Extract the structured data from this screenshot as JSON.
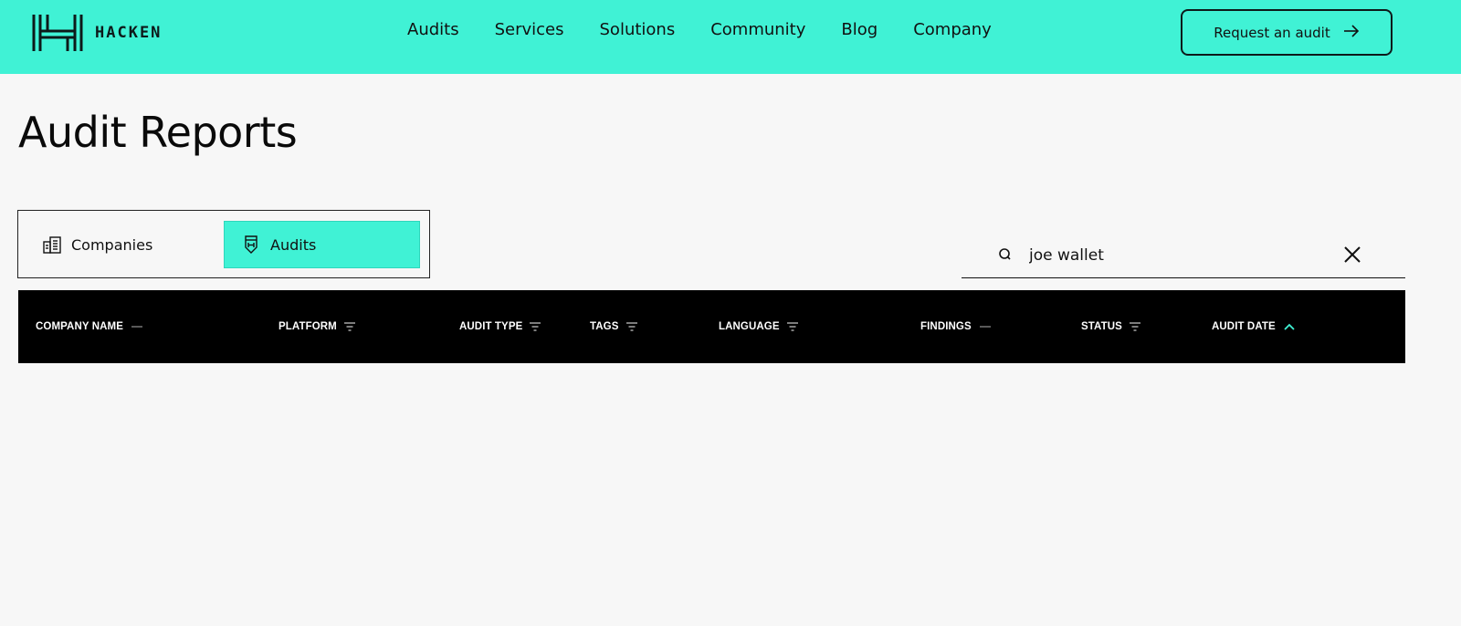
{
  "header": {
    "logo_text": "HACKEN",
    "nav": [
      "Audits",
      "Services",
      "Solutions",
      "Community",
      "Blog",
      "Company"
    ],
    "cta_label": "Request an audit",
    "brand_color": "#40f2d5"
  },
  "page": {
    "title": "Audit Reports"
  },
  "tabs": [
    {
      "label": "Companies",
      "icon": "building-icon",
      "active": false
    },
    {
      "label": "Audits",
      "icon": "shield-icon",
      "active": true
    }
  ],
  "search": {
    "value": "joe wallet"
  },
  "table": {
    "columns": [
      {
        "label": "COMPANY NAME",
        "indicator": "dash"
      },
      {
        "label": "PLATFORM",
        "indicator": "filter"
      },
      {
        "label": "AUDIT TYPE",
        "indicator": "filter"
      },
      {
        "label": "TAGS",
        "indicator": "filter"
      },
      {
        "label": "LANGUAGE",
        "indicator": "filter"
      },
      {
        "label": "FINDINGS",
        "indicator": "dash"
      },
      {
        "label": "STATUS",
        "indicator": "filter"
      },
      {
        "label": "AUDIT DATE",
        "indicator": "sort-asc"
      }
    ],
    "rows": []
  }
}
